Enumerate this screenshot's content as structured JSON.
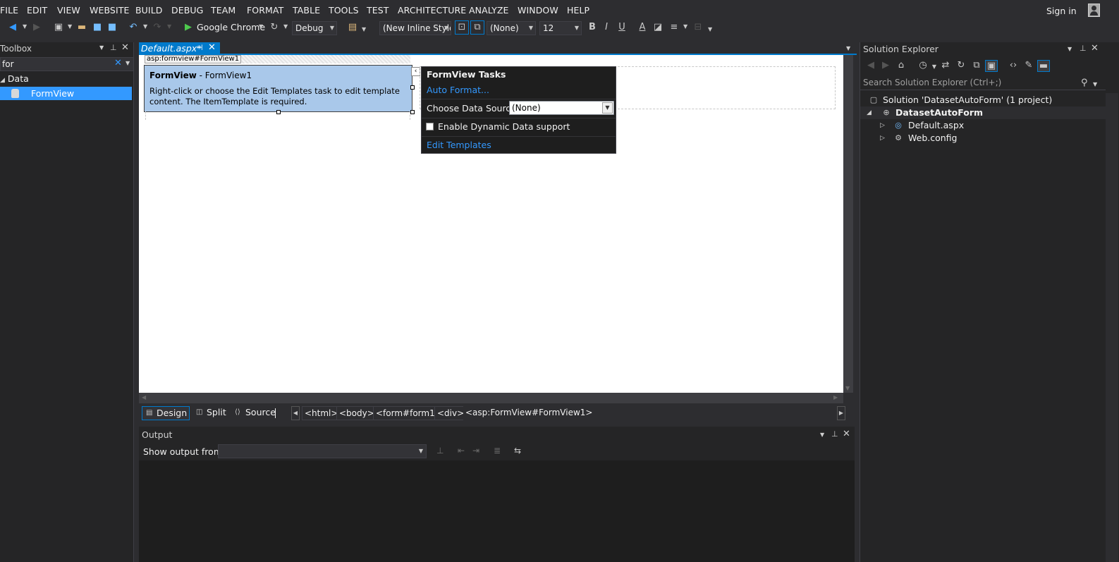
{
  "menu": [
    "FILE",
    "EDIT",
    "VIEW",
    "WEBSITE",
    "BUILD",
    "DEBUG",
    "TEAM",
    "FORMAT",
    "TABLE",
    "TOOLS",
    "TEST",
    "ARCHITECTURE",
    "ANALYZE",
    "WINDOW",
    "HELP"
  ],
  "signin": "Sign in",
  "toolbar": {
    "run_target": "Google Chrome",
    "config": "Debug",
    "style": "(New Inline Style",
    "font_name": "(None)",
    "font_size": "12",
    "bold": "B",
    "italic": "I",
    "underline": "U",
    "fore_color": "A"
  },
  "toolbox": {
    "title": "Toolbox",
    "search_value": "for",
    "group": "Data",
    "item": "FormView"
  },
  "doc_tab": {
    "label": "Default.aspx*"
  },
  "design": {
    "tag": "asp:formview#FormView1",
    "fv_title_bold": "FormView",
    "fv_title_rest": " - FormView1",
    "fv_desc": "Right-click or choose the Edit Templates task to edit template content. The ItemTemplate is required."
  },
  "tasks": {
    "title": "FormView Tasks",
    "auto_format": "Auto Format...",
    "data_source_label": "Choose Data Source:",
    "data_source_value": "(None)",
    "dynamic_data": "Enable Dynamic Data support",
    "edit_templates": "Edit Templates"
  },
  "views": {
    "design": "Design",
    "split": "Split",
    "source": "Source"
  },
  "breadcrumbs": [
    "<html>",
    "<body>",
    "<form#form1>",
    "<div>",
    "<asp:FormView#FormView1>"
  ],
  "output": {
    "title": "Output",
    "show_from": "Show output from:"
  },
  "solution_explorer": {
    "title": "Solution Explorer",
    "search_placeholder": "Search Solution Explorer (Ctrl+;)",
    "solution": "Solution 'DatasetAutoForm' (1 project)",
    "project": "DatasetAutoForm",
    "files": [
      "Default.aspx",
      "Web.config"
    ]
  },
  "colors": {
    "accent": "#007acc",
    "link": "#3399ff",
    "selection": "#3399ff",
    "formview_bg": "#a9c8ea"
  }
}
